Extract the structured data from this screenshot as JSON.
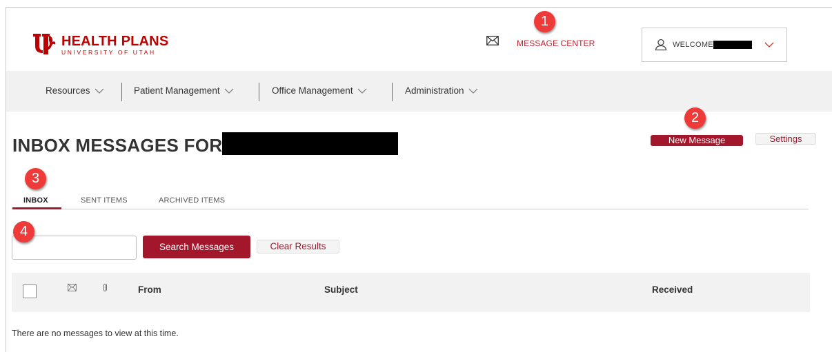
{
  "header": {
    "logo_title": "HEALTH PLANS",
    "logo_subtitle": "UNIVERSITY OF UTAH",
    "message_center_label": "MESSAGE CENTER",
    "message_icon": "envelope-icon",
    "welcome_label": "WELCOME",
    "user_icon": "user-icon",
    "chevron_icon": "chevron-down-icon"
  },
  "nav": {
    "items": [
      {
        "label": "Resources"
      },
      {
        "label": "Patient Management"
      },
      {
        "label": "Office Management"
      },
      {
        "label": "Administration"
      }
    ]
  },
  "page": {
    "title": "INBOX MESSAGES FOR",
    "new_message_label": "New Message",
    "settings_label": "Settings"
  },
  "tabs": [
    {
      "label": "INBOX",
      "active": true
    },
    {
      "label": "SENT ITEMS",
      "active": false
    },
    {
      "label": "ARCHIVED ITEMS",
      "active": false
    }
  ],
  "search": {
    "value": "",
    "placeholder": "",
    "search_label": "Search Messages",
    "clear_label": "Clear Results"
  },
  "table": {
    "columns": {
      "from": "From",
      "subject": "Subject",
      "received": "Received"
    },
    "empty_message": "There are no messages to view at this time."
  },
  "callouts": [
    "1",
    "2",
    "3",
    "4"
  ],
  "colors": {
    "brand_red": "#be0000",
    "button_red": "#a3172d",
    "callout_red": "#ef3a3a",
    "nav_bg": "#f1f1f1"
  }
}
